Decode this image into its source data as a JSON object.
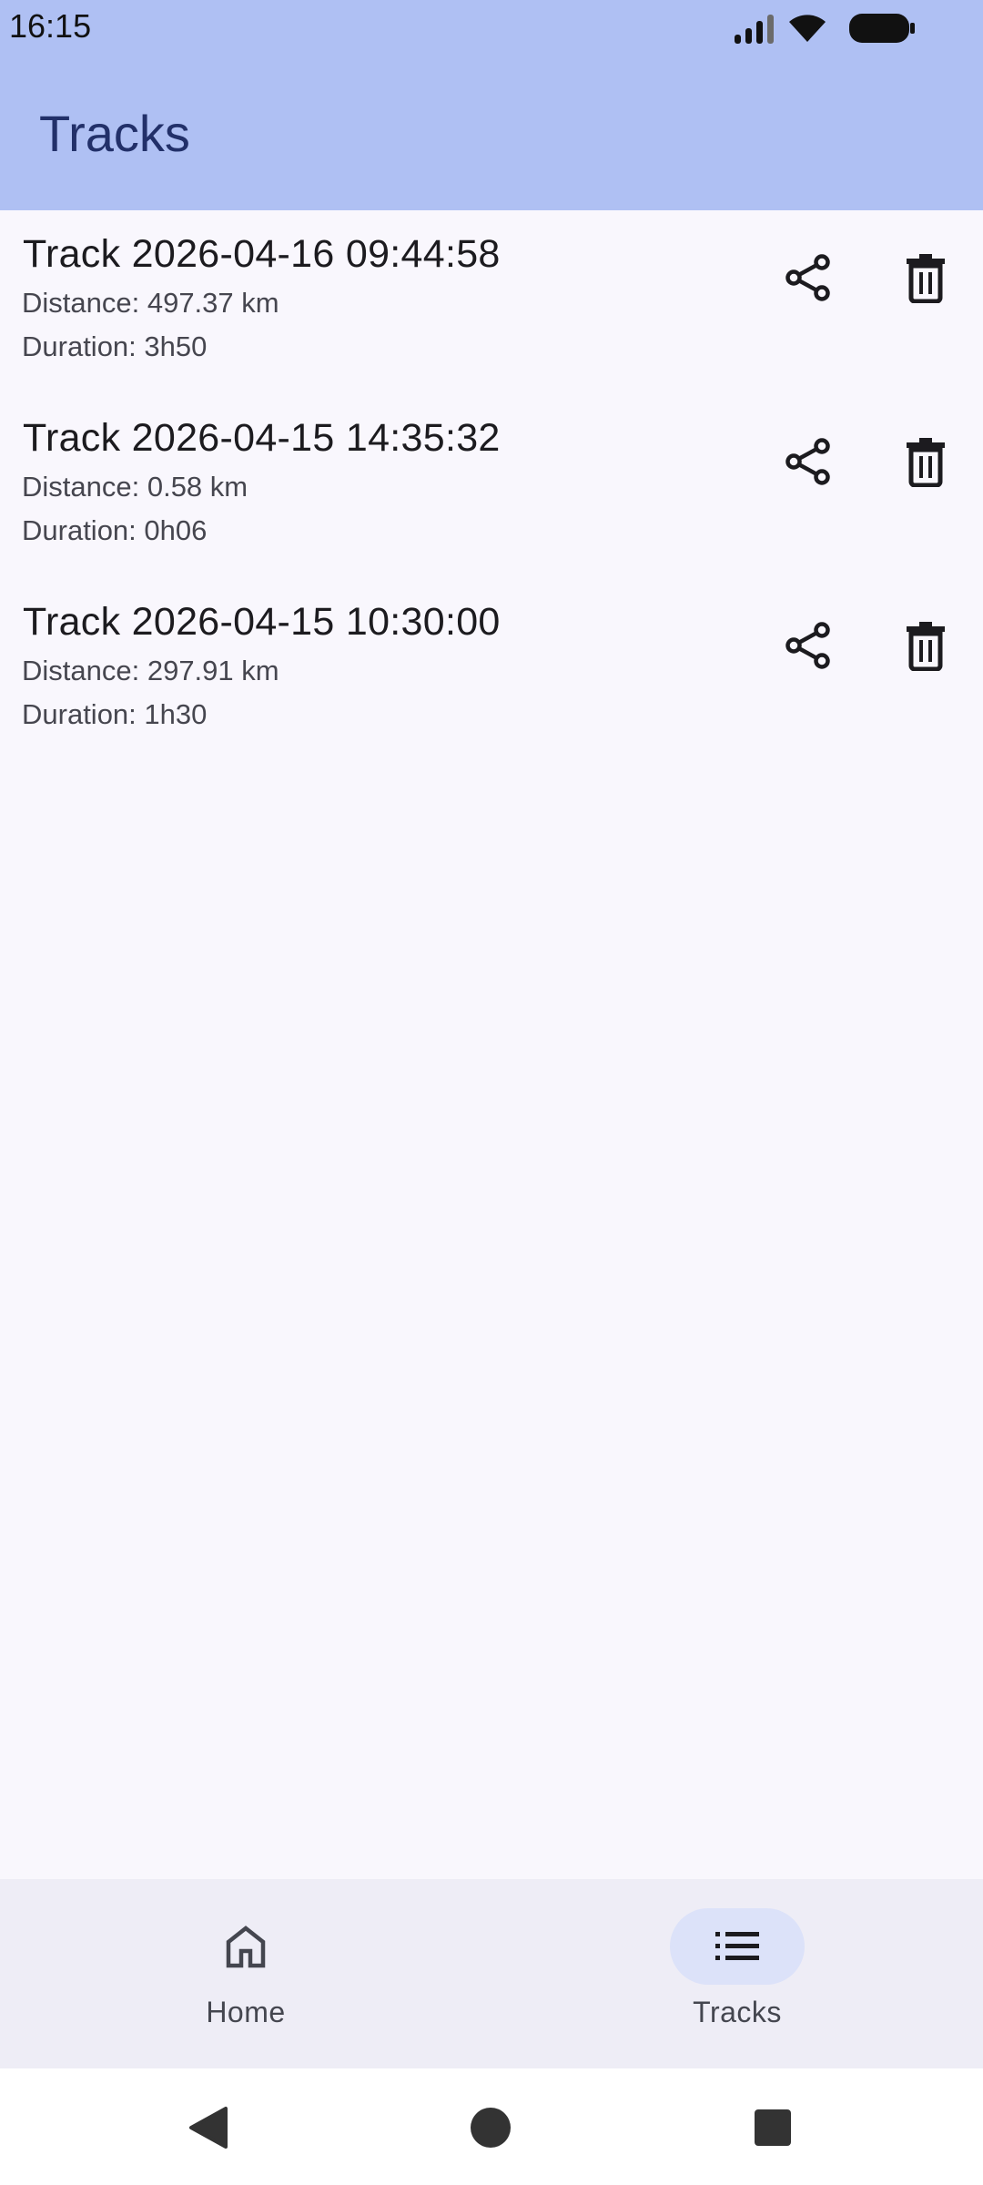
{
  "status": {
    "time": "16:15",
    "icons": [
      "signal-icon",
      "wifi-icon",
      "battery-icon"
    ]
  },
  "app_bar": {
    "title": "Tracks"
  },
  "tracks": [
    {
      "title": "Track 2026-04-16 09:44:58",
      "distance": "Distance: 497.37 km",
      "duration": "Duration: 3h50"
    },
    {
      "title": "Track 2026-04-15 14:35:32",
      "distance": "Distance: 0.58 km",
      "duration": "Duration: 0h06"
    },
    {
      "title": "Track 2026-04-15 10:30:00",
      "distance": "Distance: 297.91 km",
      "duration": "Duration: 1h30"
    }
  ],
  "track_actions": {
    "share_icon": "share-icon",
    "delete_icon": "delete-icon"
  },
  "bottom_nav": {
    "items": [
      {
        "label": "Home",
        "icon": "home-icon",
        "selected": false
      },
      {
        "label": "Tracks",
        "icon": "list-icon",
        "selected": true
      }
    ]
  },
  "system_nav": {
    "buttons": [
      "back-icon",
      "home-circle-icon",
      "recents-icon"
    ]
  },
  "colors": {
    "app_bar": "#afc0f3",
    "title": "#223069",
    "background": "#f9f7fd",
    "nav_bar": "#eeedf6",
    "nav_indicator": "#dce2f9"
  }
}
